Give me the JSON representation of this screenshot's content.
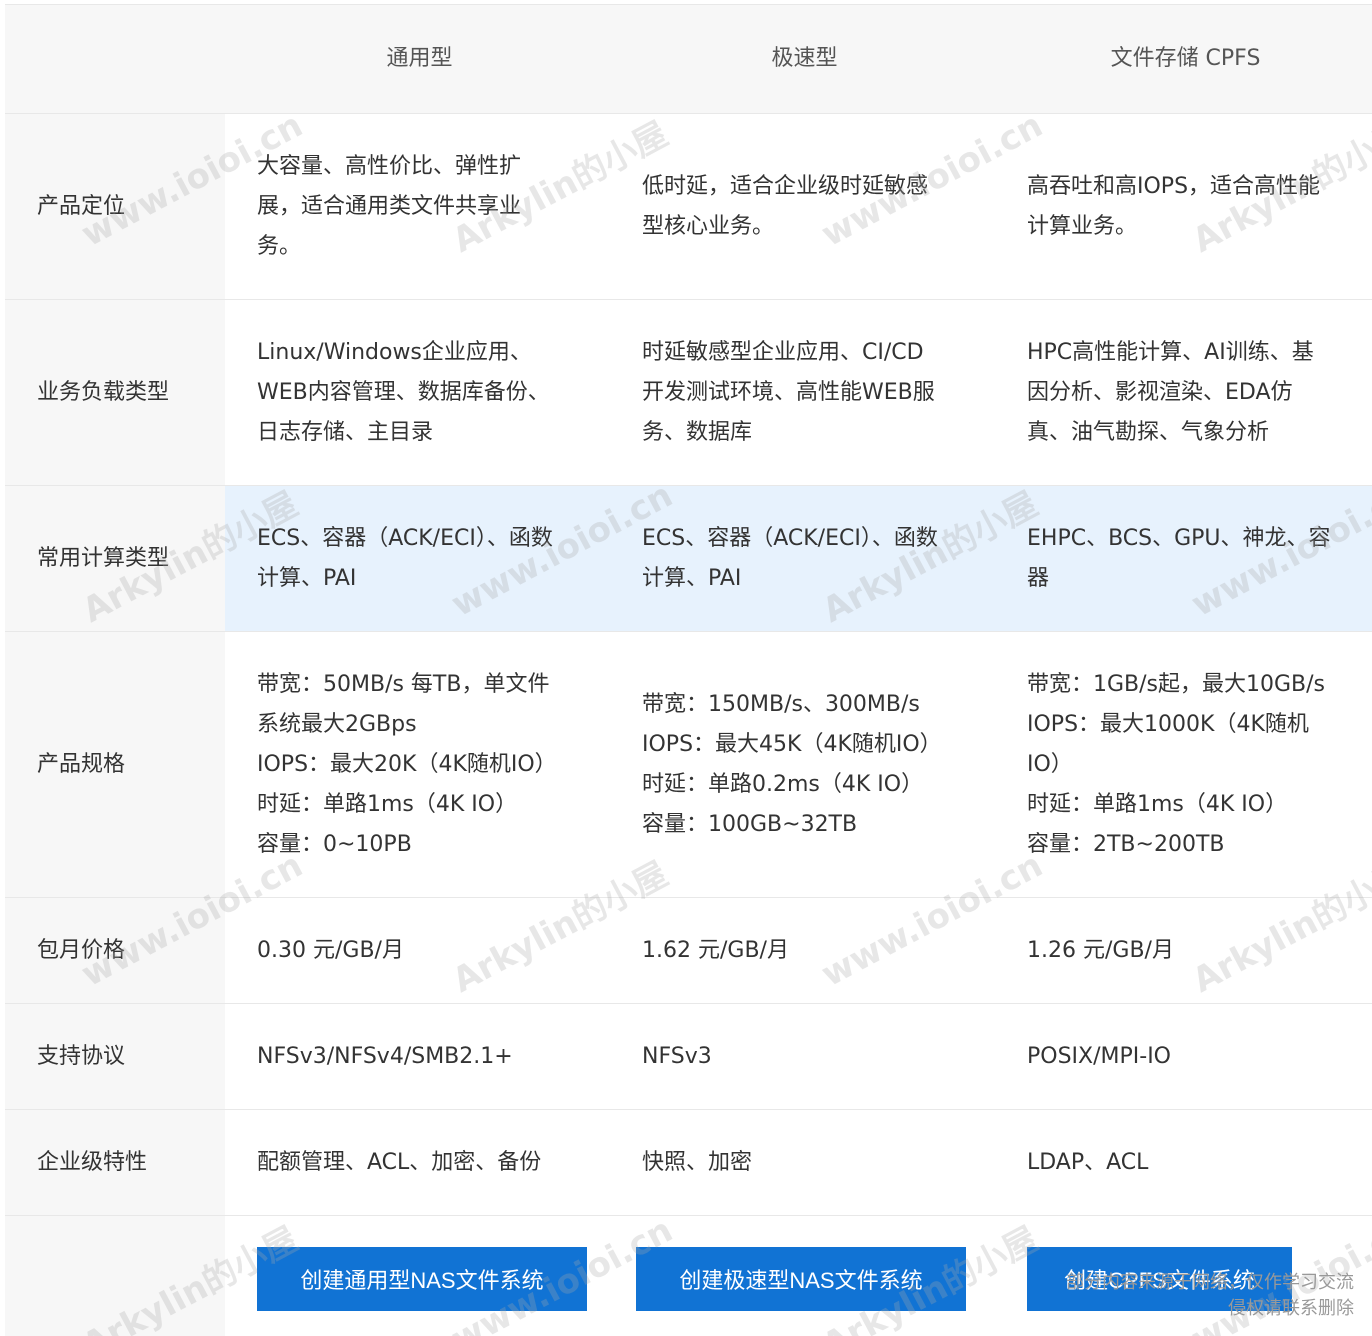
{
  "header": {
    "col1": "通用型",
    "col2": "极速型",
    "col3": "文件存储 CPFS"
  },
  "rows": [
    {
      "label": "产品定位",
      "c1": "大容量、高性价比、弹性扩\n展，适合通用类文件共享业\n务。",
      "c2": "低时延，适合企业级时延敏感\n型核心业务。",
      "c3": "高吞吐和高IOPS，适合高性能\n计算业务。"
    },
    {
      "label": "业务负载类型",
      "c1": "Linux/Windows企业应用、\nWEB内容管理、数据库备份、\n日志存储、主目录",
      "c2": "时延敏感型企业应用、CI/CD\n开发测试环境、高性能WEB服\n务、数据库",
      "c3": "HPC高性能计算、AI训练、基\n因分析、影视渲染、EDA仿\n真、油气勘探、气象分析"
    },
    {
      "label": "常用计算类型",
      "c1": "ECS、容器（ACK/ECI）、函数\n计算、PAI",
      "c2": "ECS、容器（ACK/ECI）、函数\n计算、PAI",
      "c3": "EHPC、BCS、GPU、神龙、容\n器"
    },
    {
      "label": "产品规格",
      "c1": "带宽：50MB/s 每TB，单文件\n系统最大2GBps\nIOPS：最大20K（4K随机IO）\n时延：单路1ms（4K IO）\n容量：0~10PB",
      "c2": "带宽：150MB/s、300MB/s\nIOPS：最大45K（4K随机IO）\n时延：单路0.2ms（4K IO）\n容量：100GB~32TB",
      "c3": "带宽：1GB/s起，最大10GB/s\nIOPS：最大1000K（4K随机\nIO）\n时延：单路1ms（4K IO）\n容量：2TB~200TB"
    },
    {
      "label": "包月价格",
      "c1": "0.30 元/GB/月",
      "c2": "1.62 元/GB/月",
      "c3": "1.26 元/GB/月"
    },
    {
      "label": "支持协议",
      "c1": "NFSv3/NFSv4/SMB2.1+",
      "c2": "NFSv3",
      "c3": "POSIX/MPI-IO"
    },
    {
      "label": "企业级特性",
      "c1": "配额管理、ACL、加密、备份",
      "c2": "快照、加密",
      "c3": "LDAP、ACL"
    }
  ],
  "buttons": {
    "b1": "创建通用型NAS文件系统",
    "b2": "创建极速型NAS文件系统",
    "b3": "创建CPFS文件系统"
  },
  "watermarks": {
    "site": "www.ioioi.cn",
    "name": "Arkylin的小屋"
  },
  "corner_note": {
    "line1": "部分内容来源于网络，仅作学习交流",
    "line2": "侵权请联系删除"
  },
  "colors": {
    "button": "#1173d4",
    "highlight_row": "#e7f2fd",
    "label_bg": "#f7f7f7"
  }
}
